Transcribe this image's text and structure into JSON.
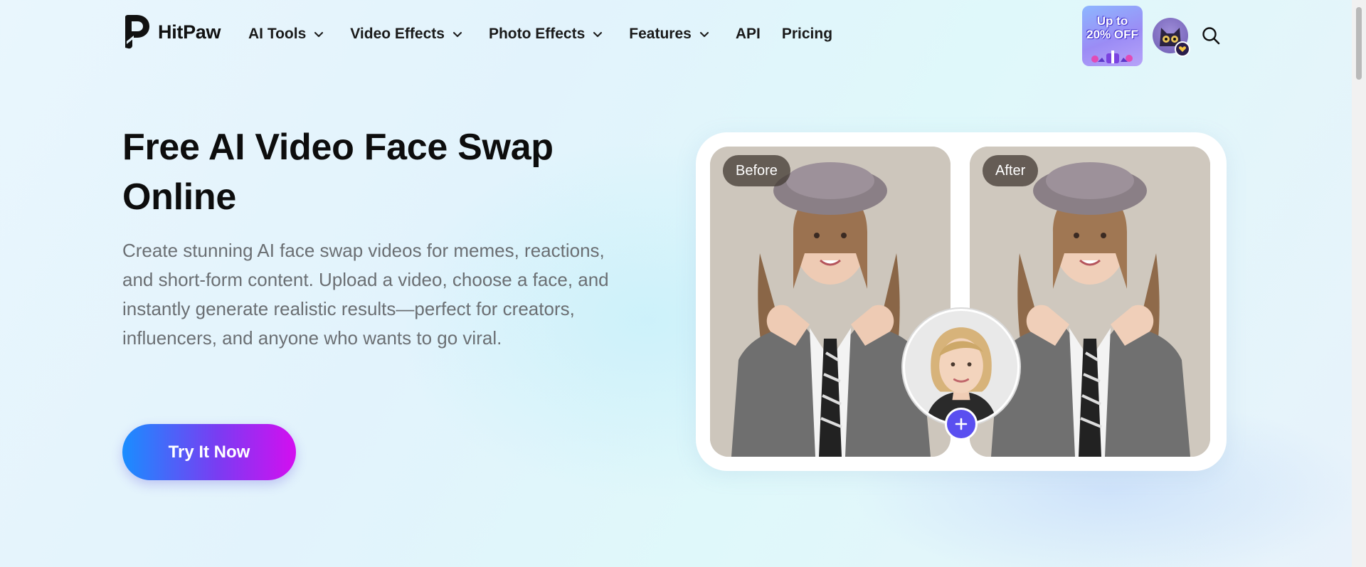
{
  "brand": {
    "name": "HitPaw"
  },
  "nav": {
    "items": [
      {
        "label": "AI Tools",
        "has_dropdown": true
      },
      {
        "label": "Video Effects",
        "has_dropdown": true
      },
      {
        "label": "Photo Effects",
        "has_dropdown": true
      },
      {
        "label": "Features",
        "has_dropdown": true
      },
      {
        "label": "API",
        "has_dropdown": false
      },
      {
        "label": "Pricing",
        "has_dropdown": false
      }
    ]
  },
  "promo": {
    "line1": "Up to",
    "line2": "20% OFF"
  },
  "hero": {
    "title": "Free AI Video Face Swap Online",
    "description": "Create stunning AI face swap videos for memes, reactions, and short-form content. Upload a video, choose a face, and instantly generate realistic results—perfect for creators, influencers, and anyone who wants to go viral.",
    "cta_label": "Try It Now"
  },
  "compare": {
    "before_label": "Before",
    "after_label": "After"
  },
  "colors": {
    "accent": "#5a4ff0",
    "cta_start": "#1a8dff",
    "cta_end": "#d40ef0",
    "text_primary": "#0d0d0d",
    "text_muted": "#6b6f73"
  },
  "icons": [
    "logo-icon",
    "chevron-down-icon",
    "search-icon",
    "plus-icon"
  ]
}
